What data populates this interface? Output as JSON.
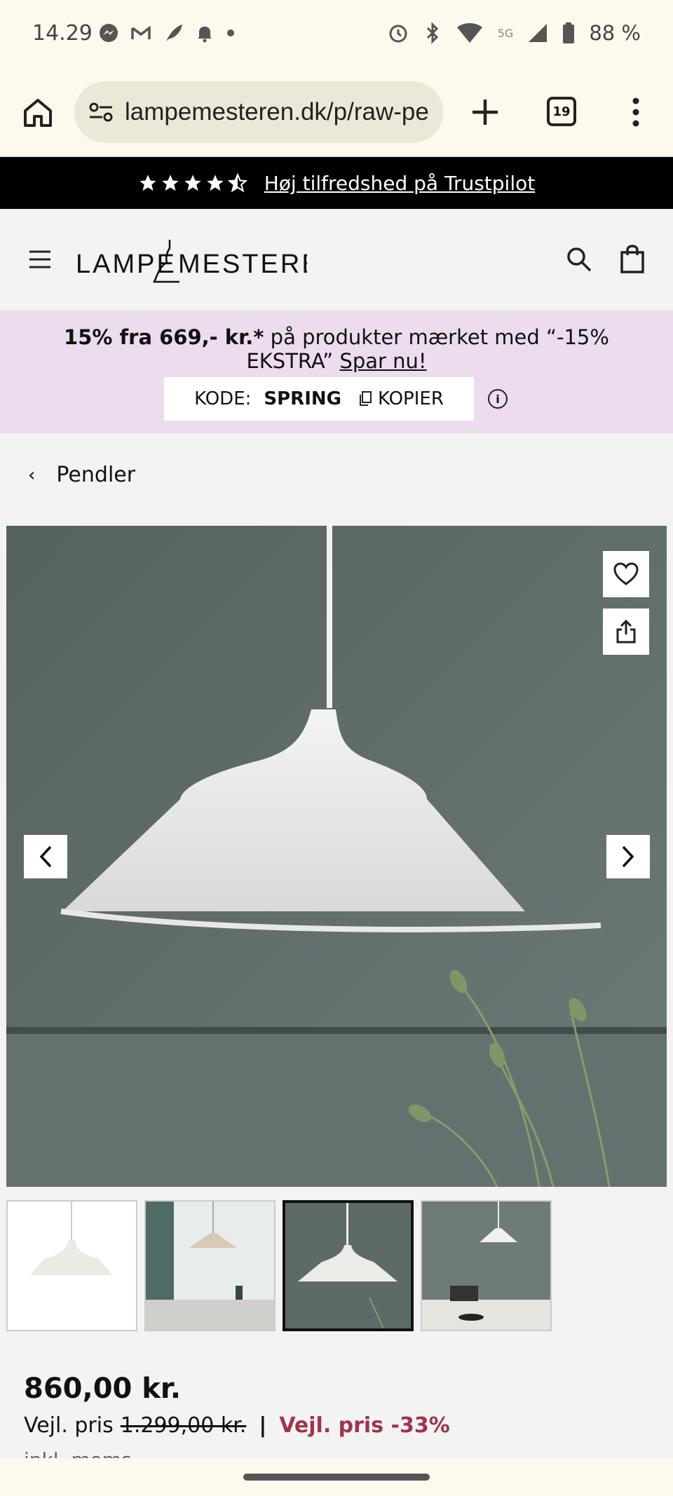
{
  "status_bar": {
    "time": "14.29",
    "battery": "88 %",
    "network": "5G"
  },
  "browser": {
    "url": "lampemesteren.dk/p/raw-pe",
    "tab_count": "19"
  },
  "trust_banner": {
    "rating_stars": 4.5,
    "text": "Høj tilfredshed på Trustpilot"
  },
  "header": {
    "logo_left": "LAMPE",
    "logo_right": "MESTEREN"
  },
  "promo": {
    "bold": "15% fra 669,- kr.*",
    "text": " på produkter mærket med “-15% EKSTRA” ",
    "link": "Spar nu!",
    "code_label": "KODE:",
    "code_value": "SPRING",
    "copy_label": "KOPIER"
  },
  "breadcrumb": {
    "label": "Pendler"
  },
  "gallery": {
    "thumbnail_count": 4,
    "active_thumbnail": 3
  },
  "price": {
    "current": "860,00 kr.",
    "rrp_label": "Vejl. pris",
    "rrp_value": "1.299,00 kr.",
    "separator": "|",
    "discount": "Vejl. pris -33%",
    "vat": "inkl. moms"
  },
  "colors": {
    "banner_bg": "#000000",
    "promo_bg": "#ecdcee",
    "discount": "#a2334a",
    "wall": "#5e6a67"
  }
}
